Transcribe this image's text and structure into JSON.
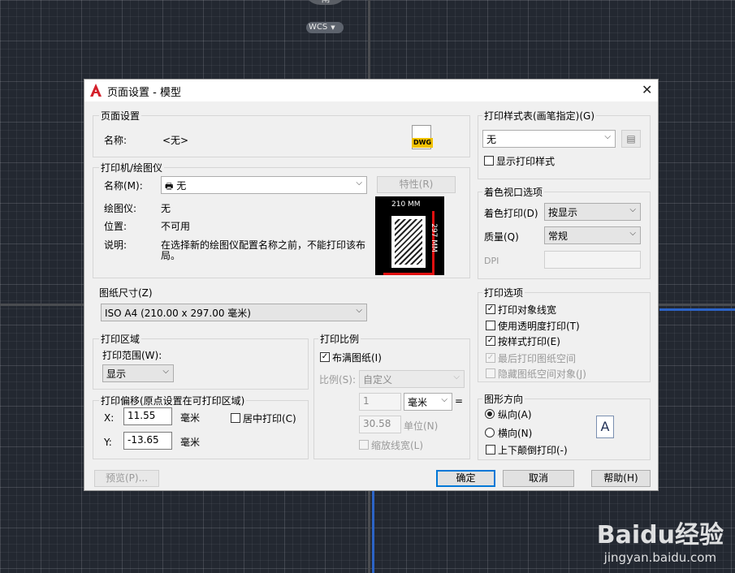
{
  "background": {
    "compass_label": "南",
    "wcs_label": "WCS"
  },
  "dialog": {
    "title": "页面设置 - 模型",
    "page_setup": {
      "group_label": "页面设置",
      "name_label": "名称:",
      "name_value": "<无>",
      "dwg_icon_text": "DWG"
    },
    "printer": {
      "group_label": "打印机/绘图仪",
      "name_label": "名称(M):",
      "name_value": "无",
      "properties_button": "特性(R)",
      "plotter_label": "绘图仪:",
      "plotter_value": "无",
      "location_label": "位置:",
      "location_value": "不可用",
      "description_label": "说明:",
      "description_value_line1": "在选择新的绘图仪配置名称之前，不能打印该布",
      "description_value_line2": "局。",
      "preview_width": "210 MM",
      "preview_height": "297 MM"
    },
    "paper_size": {
      "group_label": "图纸尺寸(Z)",
      "value": "ISO A4 (210.00 x 297.00 毫米)"
    },
    "plot_area": {
      "group_label": "打印区域",
      "range_label": "打印范围(W):",
      "range_value": "显示"
    },
    "plot_offset": {
      "group_label": "打印偏移(原点设置在可打印区域)",
      "x_label": "X:",
      "x_value": "11.55",
      "x_unit": "毫米",
      "y_label": "Y:",
      "y_value": "-13.65",
      "y_unit": "毫米",
      "center_label": "居中打印(C)"
    },
    "plot_scale": {
      "group_label": "打印比例",
      "fit_label": "布满图纸(I)",
      "scale_label": "比例(S):",
      "scale_value": "自定义",
      "value1": "1",
      "unit_value": "毫米",
      "equals": "=",
      "value2": "30.58",
      "unit_label": "单位(N)",
      "scale_lineweights": "缩放线宽(L)"
    },
    "plot_style_table": {
      "group_label": "打印样式表(画笔指定)(G)",
      "value": "无",
      "show_styles": "显示打印样式"
    },
    "shaded_viewport": {
      "group_label": "着色视口选项",
      "shade_label": "着色打印(D)",
      "shade_value": "按显示",
      "quality_label": "质量(Q)",
      "quality_value": "常规",
      "dpi_label": "DPI"
    },
    "plot_options": {
      "group_label": "打印选项",
      "items": [
        {
          "label": "打印对象线宽",
          "checked": true,
          "disabled": false
        },
        {
          "label": "使用透明度打印(T)",
          "checked": false,
          "disabled": false
        },
        {
          "label": "按样式打印(E)",
          "checked": true,
          "disabled": false
        },
        {
          "label": "最后打印图纸空间",
          "checked": true,
          "disabled": true
        },
        {
          "label": "隐藏图纸空间对象(J)",
          "checked": false,
          "disabled": true
        }
      ]
    },
    "orientation": {
      "group_label": "图形方向",
      "portrait": "纵向(A)",
      "landscape": "横向(N)",
      "upside_down": "上下颠倒打印(-)",
      "icon_letter": "A"
    },
    "buttons": {
      "preview": "预览(P)...",
      "ok": "确定",
      "cancel": "取消",
      "help": "帮助(H)"
    }
  },
  "watermark": {
    "brand": "Baidu经验",
    "url": "jingyan.baidu.com"
  }
}
